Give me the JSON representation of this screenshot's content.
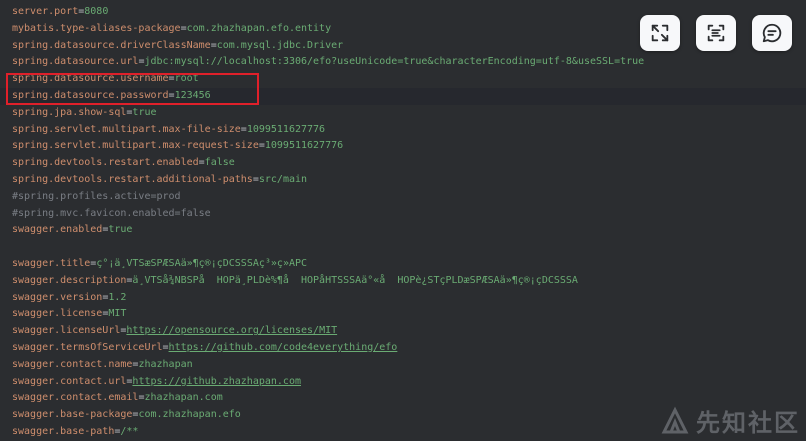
{
  "lines": [
    {
      "k": "server.port",
      "v": "8080"
    },
    {
      "k": "mybatis.type-aliases-package",
      "v": "com.zhazhapan.efo.entity"
    },
    {
      "k": "spring.datasource.driverClassName",
      "v": "com.mysql.jdbc.Driver"
    },
    {
      "k": "spring.datasource.url",
      "v": "jdbc:mysql://localhost:3306/efo?useUnicode=true&characterEncoding=utf-8&useSSL=true"
    },
    {
      "k": "spring.datasource.username",
      "v": "root"
    },
    {
      "k": "spring.datasource.password",
      "v": "123456"
    },
    {
      "k": "spring.jpa.show-sql",
      "v": "true"
    },
    {
      "k": "spring.servlet.multipart.max-file-size",
      "v": "1099511627776"
    },
    {
      "k": "spring.servlet.multipart.max-request-size",
      "v": "1099511627776"
    },
    {
      "k": "spring.devtools.restart.enabled",
      "v": "false"
    },
    {
      "k": "spring.devtools.restart.additional-paths",
      "v": "src/main"
    },
    {
      "c": "#spring.profiles.active=prod"
    },
    {
      "c": "#spring.mvc.favicon.enabled=false"
    },
    {
      "k": "swagger.enabled",
      "v": "true"
    },
    {
      "blank": true
    },
    {
      "k": "swagger.title",
      "v": "ç°¡ä¸VTSæSPÆSAä»¶ç®¡çDCSSSAç³»ç»APC"
    },
    {
      "k": "swagger.description",
      "v": "ä¸VTSå¾NBSPå  HOPä¸PLDè%¶å  HOPåHTSSSAä°«å  HOPè¿STçPLDæSPÆSAä»¶ç®¡çDCSSSA"
    },
    {
      "k": "swagger.version",
      "v": "1.2"
    },
    {
      "k": "swagger.license",
      "v": "MIT"
    },
    {
      "k": "swagger.licenseUrl",
      "v": "https://opensource.org/licenses/MIT",
      "url": true
    },
    {
      "k": "swagger.termsOfServiceUrl",
      "v": "https://github.com/code4everything/efo",
      "url": true
    },
    {
      "k": "swagger.contact.name",
      "v": "zhazhapan"
    },
    {
      "k": "swagger.contact.url",
      "v": "https://github.zhazhapan.com",
      "url": true
    },
    {
      "k": "swagger.contact.email",
      "v": "zhazhapan.com"
    },
    {
      "k": "swagger.base-package",
      "v": "com.zhazhapan.efo"
    },
    {
      "k": "swagger.base-path",
      "v": "/**"
    }
  ],
  "toolbar": {
    "icons": [
      "expand-icon",
      "text-recognize-icon",
      "comment-icon"
    ]
  },
  "watermark": {
    "text": "先知社区"
  },
  "colors": {
    "background": "#2b2d30",
    "key": "#cf8e6d",
    "value": "#6aab73",
    "comment": "#7a7e85",
    "highlight_border": "#e0202a"
  }
}
